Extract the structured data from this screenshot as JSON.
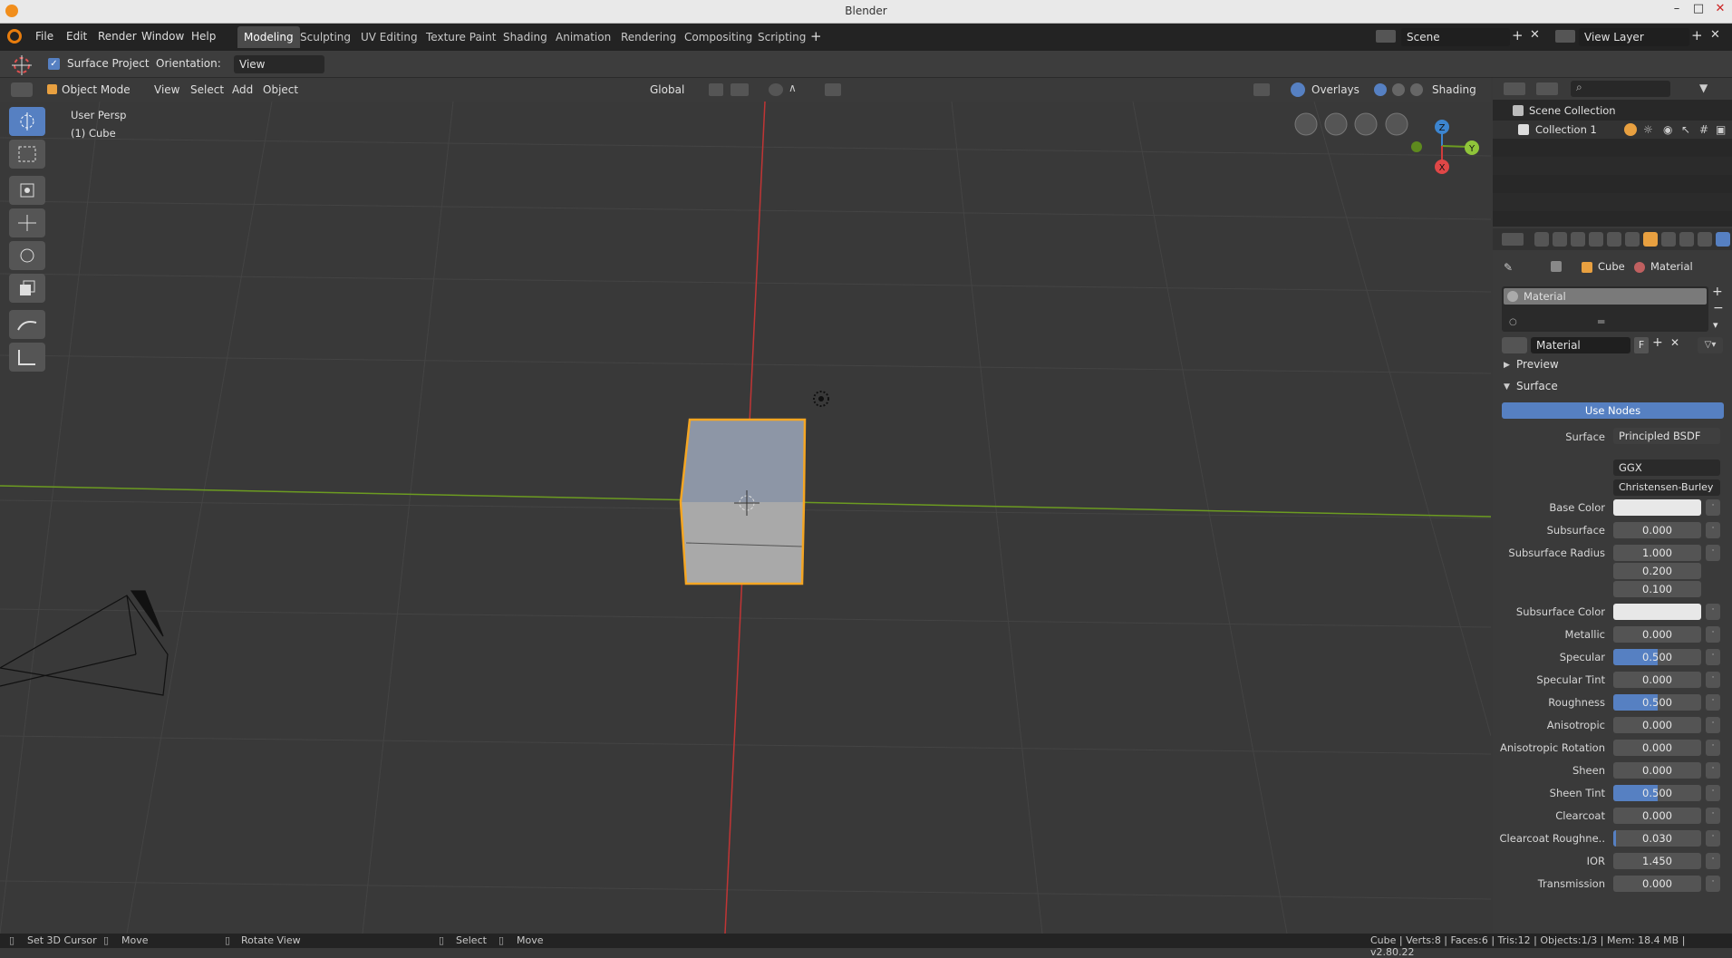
{
  "window": {
    "title": "Blender"
  },
  "menu": {
    "file": "File",
    "edit": "Edit",
    "render": "Render",
    "window": "Window",
    "help": "Help"
  },
  "workspaces": [
    "Modeling",
    "Sculpting",
    "UV Editing",
    "Texture Paint",
    "Shading",
    "Animation",
    "Rendering",
    "Compositing",
    "Scripting"
  ],
  "scene": "Scene",
  "view_layer": "View Layer",
  "tool_header": {
    "surface_project": "Surface Project",
    "orientation_label": "Orientation:",
    "orientation_value": "View"
  },
  "viewport_header": {
    "mode": "Object Mode",
    "view": "View",
    "select": "Select",
    "add": "Add",
    "object": "Object",
    "transform": "Global",
    "overlays": "Overlays",
    "shading": "Shading"
  },
  "viewport": {
    "persp": "User Persp",
    "object": "(1) Cube"
  },
  "gizmo": {
    "z": "Z",
    "y": "Y",
    "x": "X"
  },
  "outliner": {
    "scene_collection": "Scene Collection",
    "collection": "Collection 1"
  },
  "props": {
    "breadcrumb_object": "Cube",
    "breadcrumb_material": "Material",
    "slot": "Material",
    "material_name": "Material",
    "fake_user": "F",
    "preview": "Preview",
    "surface_panel": "Surface",
    "use_nodes": "Use Nodes",
    "surface_label": "Surface",
    "surface_value": "Principled BSDF",
    "distribution": "GGX",
    "subsurface_method": "Christensen-Burley",
    "rows": [
      {
        "label": "Base Color",
        "value": "",
        "type": "color"
      },
      {
        "label": "Subsurface",
        "value": "0.000",
        "fill": 0
      },
      {
        "label": "Subsurface Radius",
        "value": "1.000",
        "fill": 0
      },
      {
        "label": "",
        "value": "0.200",
        "fill": 0
      },
      {
        "label": "",
        "value": "0.100",
        "fill": 0
      },
      {
        "label": "Subsurface Color",
        "value": "",
        "type": "color"
      },
      {
        "label": "Metallic",
        "value": "0.000",
        "fill": 0
      },
      {
        "label": "Specular",
        "value": "0.500",
        "fill": 0.5
      },
      {
        "label": "Specular Tint",
        "value": "0.000",
        "fill": 0
      },
      {
        "label": "Roughness",
        "value": "0.500",
        "fill": 0.5
      },
      {
        "label": "Anisotropic",
        "value": "0.000",
        "fill": 0
      },
      {
        "label": "Anisotropic Rotation",
        "value": "0.000",
        "fill": 0
      },
      {
        "label": "Sheen",
        "value": "0.000",
        "fill": 0
      },
      {
        "label": "Sheen Tint",
        "value": "0.500",
        "fill": 0.5
      },
      {
        "label": "Clearcoat",
        "value": "0.000",
        "fill": 0
      },
      {
        "label": "Clearcoat Roughne..",
        "value": "0.030",
        "fill": 0.03
      },
      {
        "label": "IOR",
        "value": "1.450",
        "fill": 0
      },
      {
        "label": "Transmission",
        "value": "0.000",
        "fill": 0
      }
    ]
  },
  "status": {
    "set_cursor": "Set 3D Cursor",
    "move1": "Move",
    "rotate": "Rotate View",
    "select": "Select",
    "move2": "Move",
    "stats": "Cube | Verts:8 | Faces:6 | Tris:12 | Objects:1/3 | Mem: 18.4 MB | v2.80.22"
  },
  "colors": {
    "accent": "#5680c2",
    "selection": "#f5a623",
    "x_axis": "#d03c3c",
    "y_axis": "#6c9b21",
    "z_axis": "#3c85d0"
  }
}
